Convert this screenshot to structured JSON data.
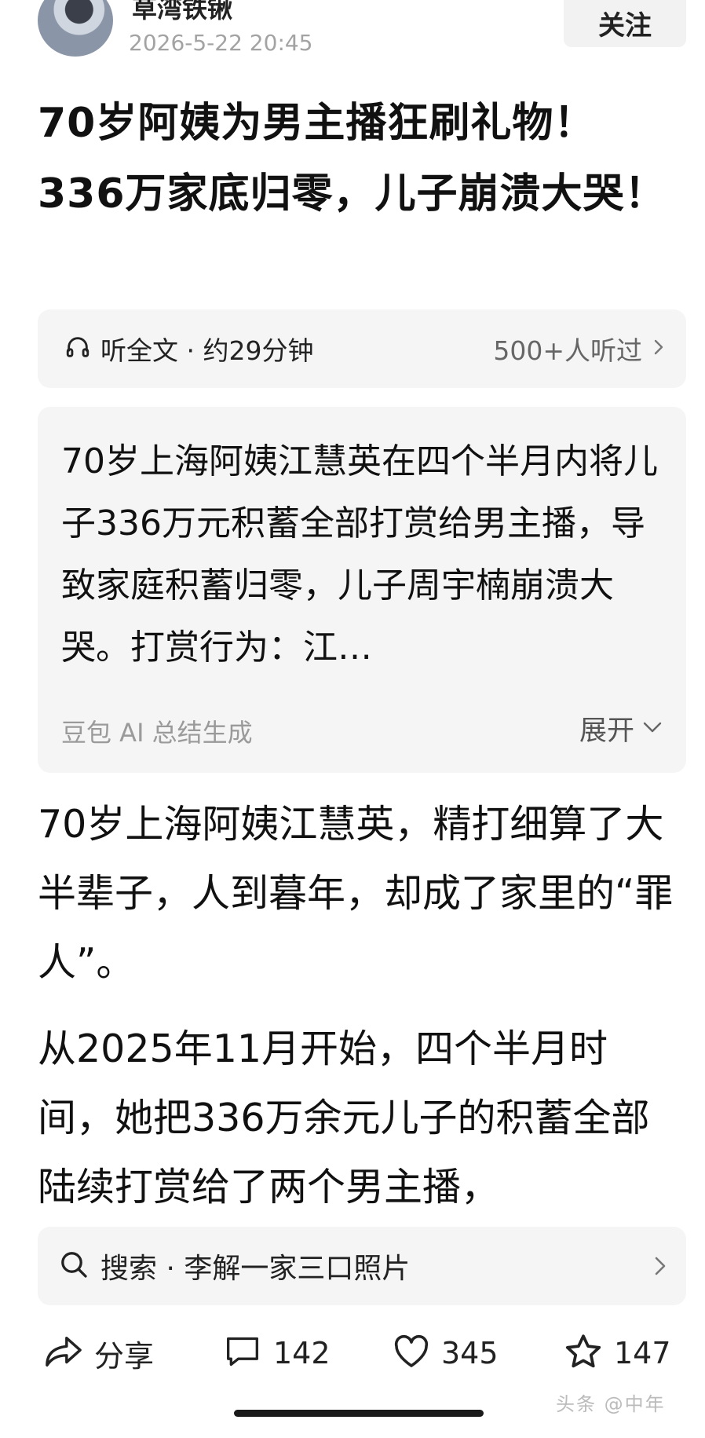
{
  "header": {
    "author_name": "草湾铁锹",
    "post_time": "2026-5-22 20:45",
    "follow_label": "关注"
  },
  "article": {
    "title": "70岁阿姨为男主播狂刷礼物！336万家底归零，儿子崩溃大哭！",
    "paragraphs": [
      "70岁上海阿姨江慧英，精打细算了大半辈子，人到暮年，却成了家里的“罪人”。",
      "从2025年11月开始，四个半月时间，她把336万余元儿子的积蓄全部陆续打赏给了两个男主播，"
    ]
  },
  "listen": {
    "text": "听全文 · 约29分钟",
    "count": "500+人听过",
    "icon": "headphones-icon"
  },
  "summary": {
    "text": "70岁上海阿姨江慧英在四个半月内将儿子336万元积蓄全部打赏给男主播，导致家庭积蓄归零，儿子周宇楠崩溃大哭。打赏行为：江…",
    "source": "豆包 AI 总结生成",
    "expand_label": "展开"
  },
  "search": {
    "text": "搜索 · 李解一家三口照片",
    "icon": "search-icon"
  },
  "actions": {
    "share_label": "分享",
    "comments_count": "142",
    "likes_count": "345",
    "favorites_count": "147"
  },
  "watermark": "头条 @中年"
}
